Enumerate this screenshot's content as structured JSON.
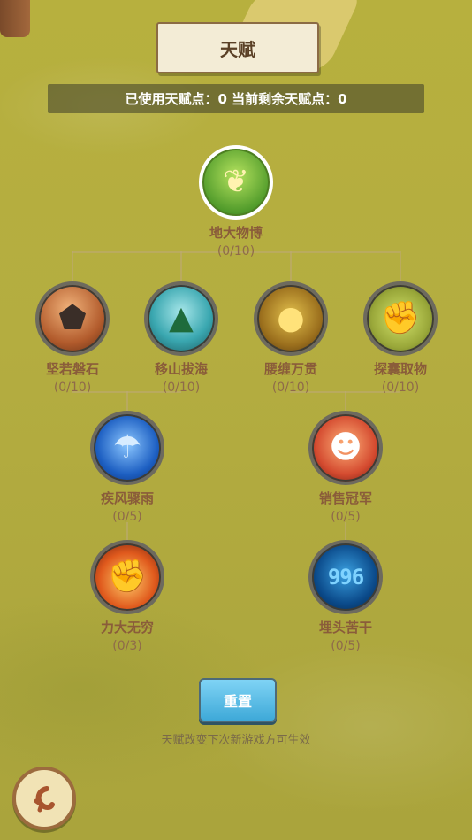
{
  "header": {
    "title": "天赋",
    "points_text": "已使用天赋点：0 当前剩余天赋点：0"
  },
  "talents": {
    "root": {
      "name": "地大物博",
      "progress": "(0/10)",
      "icon": "wheat-icon"
    },
    "tier1": [
      {
        "name": "坚若磐石",
        "progress": "(0/10)",
        "icon": "rock-icon"
      },
      {
        "name": "移山拔海",
        "progress": "(0/10)",
        "icon": "mountain-icon"
      },
      {
        "name": "腰缠万贯",
        "progress": "(0/10)",
        "icon": "coins-icon"
      },
      {
        "name": "探囊取物",
        "progress": "(0/10)",
        "icon": "grab-hand-icon"
      }
    ],
    "tier2": [
      {
        "name": "疾风骤雨",
        "progress": "(0/5)",
        "icon": "rain-icon"
      },
      {
        "name": "销售冠军",
        "progress": "(0/5)",
        "icon": "sales-panda-icon"
      }
    ],
    "tier3": [
      {
        "name": "力大无穷",
        "progress": "(0/3)",
        "icon": "flaming-fist-icon"
      },
      {
        "name": "埋头苦干",
        "progress": "(0/5)",
        "icon": "number-996-icon",
        "icon_text": "996"
      }
    ]
  },
  "reset_label": "重置",
  "notice": "天赋改变下次新游戏方可生效",
  "colors": {
    "label_brown": "#8a5c3a",
    "reset_blue": "#4fb8e4",
    "background_olive": "#b4ad40"
  }
}
